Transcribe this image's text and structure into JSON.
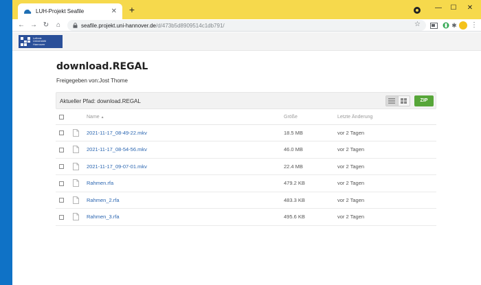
{
  "browser": {
    "tab_title": "LUH-Projekt Seafile",
    "tab_close": "✕",
    "new_tab": "+",
    "url_host": "seafile.projekt.uni-hannover.de",
    "url_path": "/d/473b5d8909514c1db791/",
    "window_controls": [
      "—",
      "☐",
      "✕"
    ]
  },
  "logo": {
    "lines": [
      "Leibniz",
      "Universität",
      "Hannover"
    ]
  },
  "page": {
    "title": "download.REGAL",
    "shared_by": "Freigegeben von:Jost Thome",
    "current_path": "Aktueller Pfad: download.REGAL",
    "zip_label": "ZIP"
  },
  "table": {
    "headers": {
      "name": "Name",
      "sort_indicator": "▲",
      "size": "Größe",
      "modified": "Letzte Änderung"
    },
    "rows": [
      {
        "name": "2021-11-17_08-49-22.mkv",
        "size": "18.5 MB",
        "modified": "vor 2 Tagen"
      },
      {
        "name": "2021-11-17_08-54-56.mkv",
        "size": "46.0 MB",
        "modified": "vor 2 Tagen"
      },
      {
        "name": "2021-11-17_09-07-01.mkv",
        "size": "22.4 MB",
        "modified": "vor 2 Tagen"
      },
      {
        "name": "Rahmen.rfa",
        "size": "479.2 KB",
        "modified": "vor 2 Tagen"
      },
      {
        "name": "Rahmen_2.rfa",
        "size": "483.3 KB",
        "modified": "vor 2 Tagen"
      },
      {
        "name": "Rahmen_3.rfa",
        "size": "495.6 KB",
        "modified": "vor 2 Tagen"
      }
    ]
  },
  "colors": {
    "desktop": "#0f72c6",
    "titlebar": "#f6d94c",
    "zip_button": "#57a639",
    "link": "#2a65b0",
    "logo": "#2a4f99"
  }
}
